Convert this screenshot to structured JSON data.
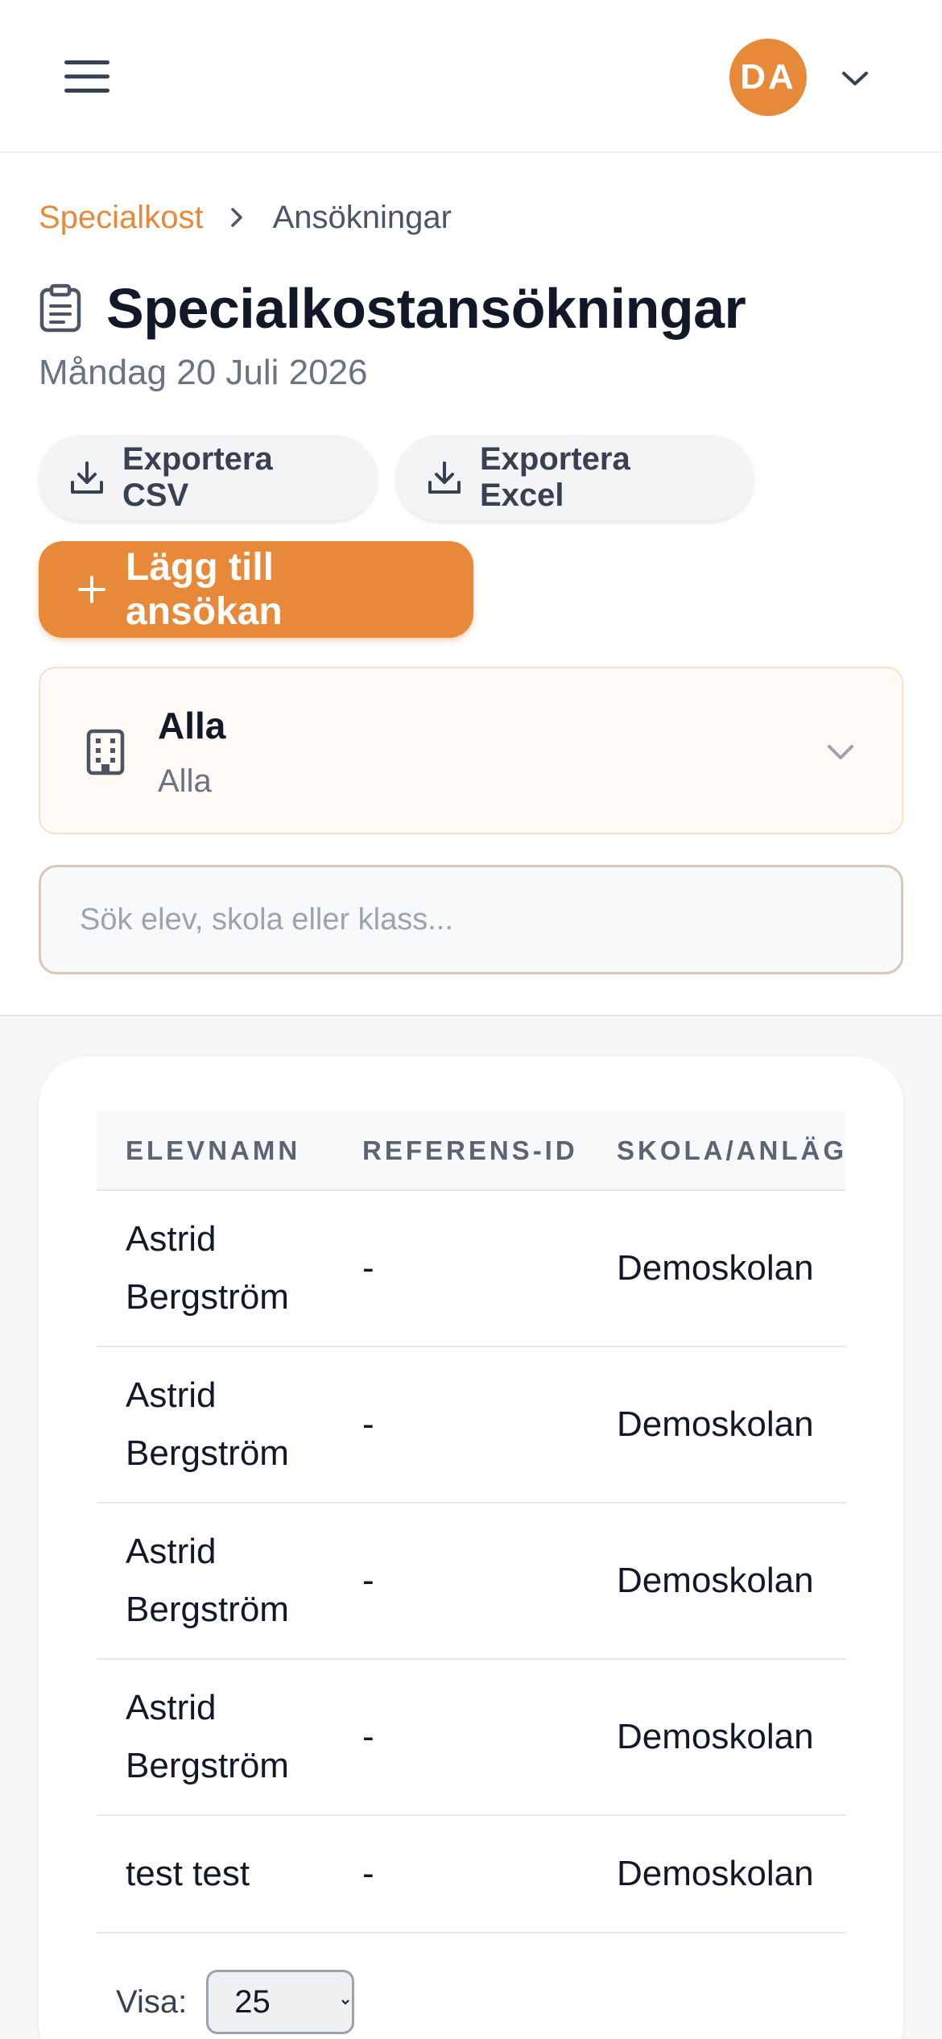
{
  "header": {
    "avatar_initials": "DA"
  },
  "breadcrumb": {
    "parent": "Specialkost",
    "current": "Ansökningar"
  },
  "page": {
    "title": "Specialkostansökningar",
    "date": "Måndag 20 Juli 2026"
  },
  "actions": {
    "export_csv": "Exportera CSV",
    "export_excel": "Exportera Excel",
    "add_application": "Lägg till ansökan"
  },
  "selector": {
    "title": "Alla",
    "subtitle": "Alla"
  },
  "search": {
    "placeholder": "Sök elev, skola eller klass..."
  },
  "table": {
    "columns": [
      "ELEVNAMN",
      "REFERENS-ID",
      "SKOLA/ANLÄGGNING"
    ],
    "rows": [
      {
        "name": "Astrid Bergström",
        "ref": "-",
        "school": "Demoskolan"
      },
      {
        "name": "Astrid Bergström",
        "ref": "-",
        "school": "Demoskolan"
      },
      {
        "name": "Astrid Bergström",
        "ref": "-",
        "school": "Demoskolan"
      },
      {
        "name": "Astrid Bergström",
        "ref": "-",
        "school": "Demoskolan"
      },
      {
        "name": "test test",
        "ref": "-",
        "school": "Demoskolan"
      }
    ]
  },
  "pager": {
    "label": "Visa:",
    "selected": "25",
    "options": [
      "25"
    ]
  },
  "colors": {
    "accent": "#e8893a",
    "text": "#111827",
    "muted": "#6b7280"
  },
  "icons": [
    "menu-icon",
    "chevron-down-icon",
    "chevron-right-icon",
    "clipboard-icon",
    "download-icon",
    "plus-icon",
    "building-icon"
  ]
}
